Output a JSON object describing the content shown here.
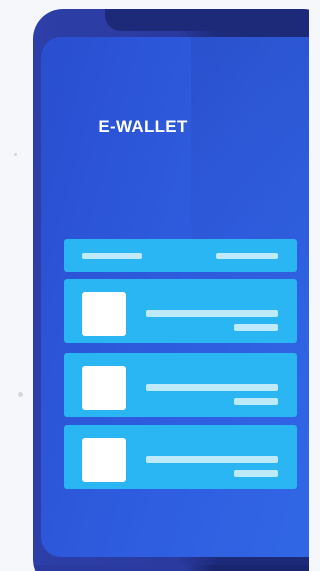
{
  "app": {
    "title": "E-WALLET"
  },
  "colors": {
    "background": "#f6f7fa",
    "phone_frame": "#2d3fa8",
    "screen": "#2f5ee0",
    "card": "#2ab6f3",
    "card_line": "#bfe9fd",
    "thumbnail": "#ffffff"
  },
  "list": {
    "items": [
      {
        "icon": "image-placeholder-icon"
      },
      {
        "icon": "image-placeholder-icon"
      },
      {
        "icon": "image-placeholder-icon"
      }
    ]
  }
}
